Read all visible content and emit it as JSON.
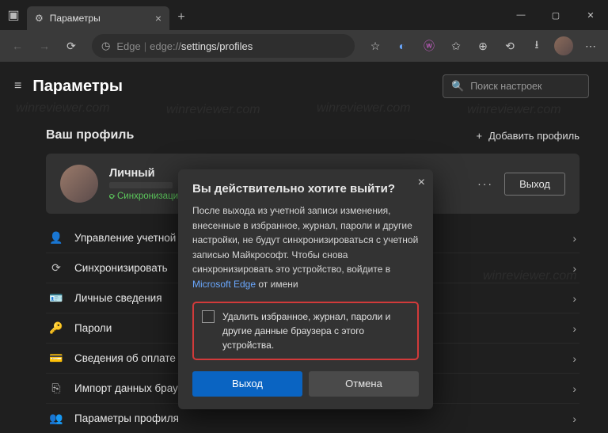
{
  "titlebar": {
    "tab_title": "Параметры"
  },
  "toolbar": {
    "brand": "Edge",
    "url_scheme": "edge://",
    "url_path": "settings/profiles"
  },
  "page": {
    "title": "Параметры",
    "search_placeholder": "Поиск настроек",
    "section_title": "Ваш профиль",
    "add_profile": "Добавить профиль"
  },
  "profile": {
    "name": "Личный",
    "sync_status": "Синхронизация вкл",
    "more": "···",
    "logout": "Выход"
  },
  "menu": [
    {
      "icon": "person-icon",
      "glyph": "👤",
      "label": "Управление учетной записью"
    },
    {
      "icon": "sync-icon",
      "glyph": "⟳",
      "label": "Синхронизировать"
    },
    {
      "icon": "id-card-icon",
      "glyph": "🪪",
      "label": "Личные сведения"
    },
    {
      "icon": "key-icon",
      "glyph": "🔑",
      "label": "Пароли"
    },
    {
      "icon": "card-icon",
      "glyph": "💳",
      "label": "Сведения об оплате"
    },
    {
      "icon": "import-icon",
      "glyph": "⎘",
      "label": "Импорт данных браузера"
    },
    {
      "icon": "profile-icon",
      "glyph": "👥",
      "label": "Параметры профиля"
    }
  ],
  "dialog": {
    "title": "Вы действительно хотите выйти?",
    "body_1": "После выхода из учетной записи изменения, внесенные в избранное, журнал, пароли и другие настройки, не будут синхронизироваться с учетной записью Майкрософт. Чтобы снова синхронизировать это устройство, войдите в ",
    "body_link": "Microsoft Edge",
    "body_2": " от имени",
    "checkbox_label": "Удалить избранное, журнал, пароли и другие данные браузера с этого устройства.",
    "primary": "Выход",
    "secondary": "Отмена"
  },
  "watermark": "winreviewer.com"
}
